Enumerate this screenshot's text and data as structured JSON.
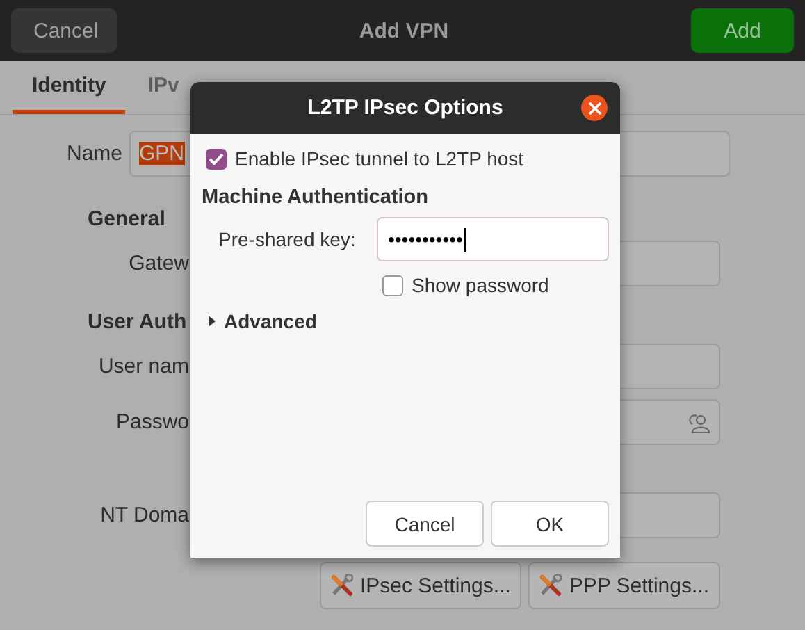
{
  "window": {
    "title": "Add VPN",
    "cancel_button": "Cancel",
    "add_button": "Add"
  },
  "tabs": [
    {
      "label": "Identity",
      "selected": true
    },
    {
      "label": "IPv",
      "selected": false
    }
  ],
  "name_row": {
    "label": "Name",
    "value": "GPN",
    "value_selected": true
  },
  "sections": [
    {
      "heading": "General",
      "rows": [
        {
          "label": "Gatew",
          "kind": "text"
        }
      ]
    },
    {
      "heading": "User Auth",
      "rows": [
        {
          "label": "User nam",
          "kind": "text"
        },
        {
          "label": "Passwo",
          "kind": "password"
        },
        {
          "label": "NT Doma",
          "kind": "text"
        }
      ]
    }
  ],
  "settings_buttons": [
    "IPsec Settings...",
    "PPP Settings..."
  ],
  "dialog": {
    "title": "L2TP IPsec Options",
    "enable_ipsec": {
      "label": "Enable IPsec tunnel to L2TP host",
      "checked": true
    },
    "section_heading": "Machine Authentication",
    "psk_label": "Pre-shared key:",
    "psk_value": "•••••••••••",
    "show_password": {
      "label": "Show password",
      "checked": false
    },
    "advanced": {
      "label": "Advanced",
      "expanded": false
    },
    "buttons": [
      "Cancel",
      "OK"
    ]
  }
}
